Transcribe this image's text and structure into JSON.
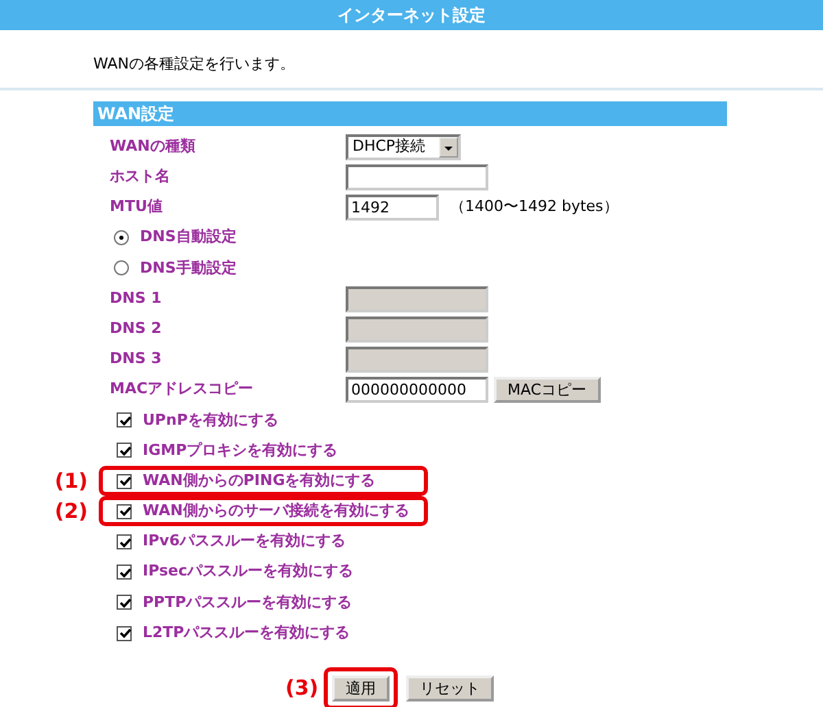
{
  "header": {
    "title": "インターネット設定"
  },
  "description": "WANの各種設定を行います。",
  "section": {
    "title": "WAN設定"
  },
  "rows": [
    {
      "kind": "select",
      "label": "WANの種類",
      "value": "DHCP接続"
    },
    {
      "kind": "text",
      "label": "ホスト名",
      "value": ""
    },
    {
      "kind": "text",
      "label": "MTU値",
      "value": "1492",
      "note": "（1400〜1492 bytes）"
    },
    {
      "kind": "radio",
      "label": "DNS自動設定",
      "selected": true
    },
    {
      "kind": "radio",
      "label": "DNS手動設定",
      "selected": false
    },
    {
      "kind": "text",
      "label": "DNS 1",
      "value": "",
      "disabled": true
    },
    {
      "kind": "text",
      "label": "DNS 2",
      "value": "",
      "disabled": true
    },
    {
      "kind": "text",
      "label": "DNS 3",
      "value": "",
      "disabled": true
    },
    {
      "kind": "text",
      "label": "MACアドレスコピー",
      "value": "000000000000",
      "button": "MACコピー"
    },
    {
      "kind": "checkbox",
      "label": "UPnPを有効にする",
      "checked": true
    },
    {
      "kind": "checkbox",
      "label": "IGMPプロキシを有効にする",
      "checked": true
    },
    {
      "kind": "checkbox",
      "label": "WAN側からのPINGを有効にする",
      "checked": true,
      "callout": "(1)"
    },
    {
      "kind": "checkbox",
      "label": "WAN側からのサーバ接続を有効にする",
      "checked": true,
      "callout": "(2)"
    },
    {
      "kind": "checkbox",
      "label": "IPv6パススルーを有効にする",
      "checked": true
    },
    {
      "kind": "checkbox",
      "label": "IPsecパススルーを有効にする",
      "checked": true
    },
    {
      "kind": "checkbox",
      "label": "PPTPパススルーを有効にする",
      "checked": true
    },
    {
      "kind": "checkbox",
      "label": "L2TPパススルーを有効にする",
      "checked": true
    }
  ],
  "buttons": [
    {
      "label": "適用",
      "callout": "(3)"
    },
    {
      "label": "リセット"
    }
  ]
}
